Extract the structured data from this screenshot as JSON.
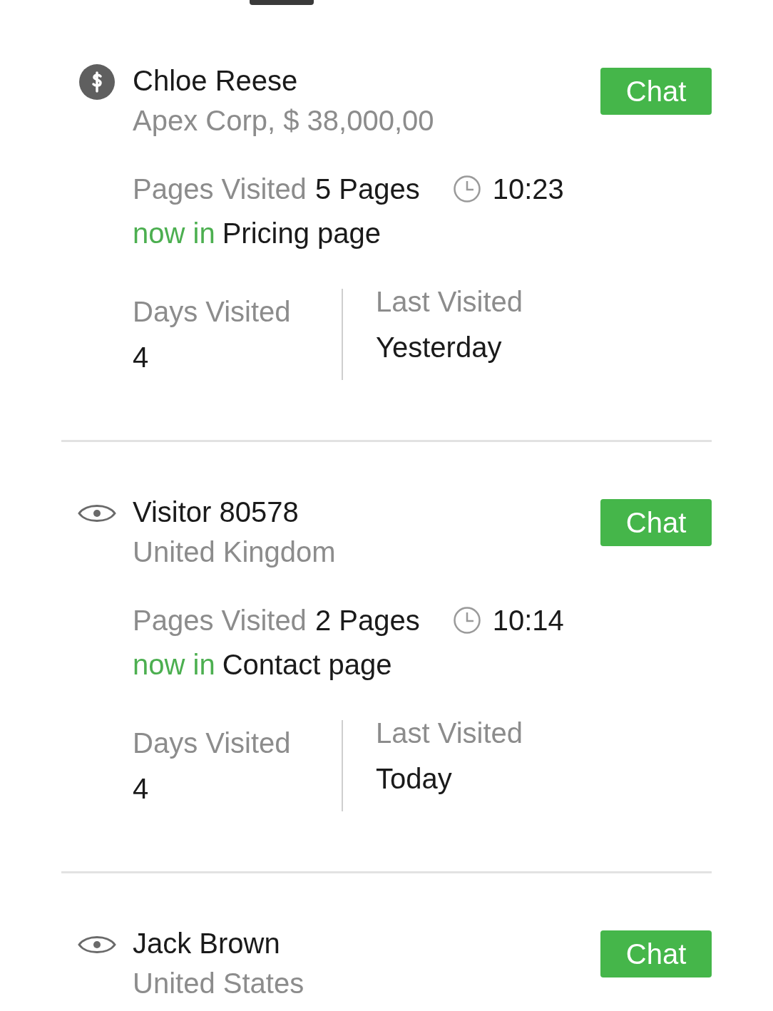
{
  "visitors": [
    {
      "kind": "customer",
      "name": "Chloe Reese",
      "subtitle": "Apex Corp, $ 38,000,00",
      "chat": "Chat",
      "details": {
        "pages_label": "Pages Visited",
        "pages": "5 Pages",
        "time": "10:23",
        "now_in_label": "now in",
        "current_page": "Pricing page",
        "days_label": "Days Visited",
        "days": "4",
        "last_label": "Last Visited",
        "last": "Yesterday"
      }
    },
    {
      "kind": "visitor",
      "name": "Visitor 80578",
      "subtitle": "United Kingdom",
      "chat": "Chat",
      "details": {
        "pages_label": "Pages Visited",
        "pages": "2 Pages",
        "time": "10:14",
        "now_in_label": "now in",
        "current_page": "Contact page",
        "days_label": "Days Visited",
        "days": "4",
        "last_label": "Last Visited",
        "last": "Today"
      }
    },
    {
      "kind": "visitor",
      "name": "Jack Brown",
      "subtitle": "United States",
      "chat": "Chat"
    }
  ]
}
